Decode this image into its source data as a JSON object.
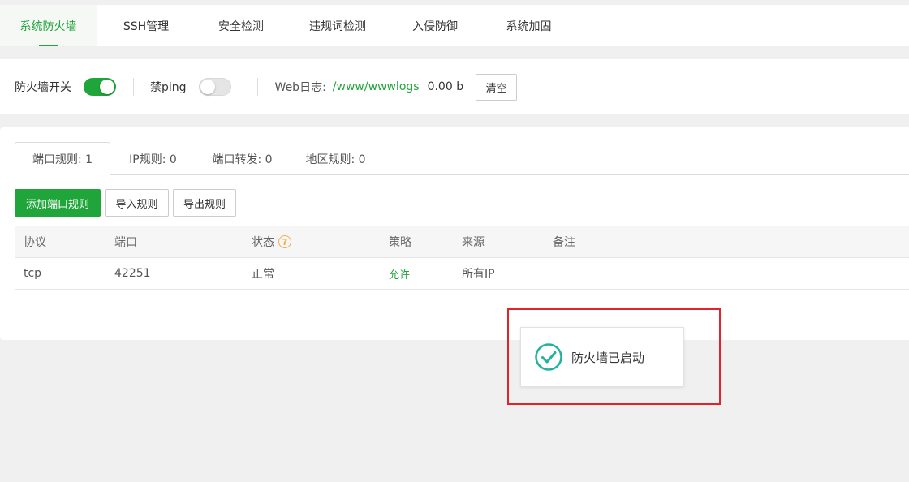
{
  "topnav": {
    "tabs": [
      {
        "label": "系统防火墙",
        "active": true
      },
      {
        "label": "SSH管理",
        "active": false
      },
      {
        "label": "安全检测",
        "active": false
      },
      {
        "label": "违规词检测",
        "active": false
      },
      {
        "label": "入侵防御",
        "active": false
      },
      {
        "label": "系统加固",
        "active": false
      }
    ]
  },
  "controls": {
    "firewall_label": "防火墙开关",
    "firewall_on": true,
    "ping_label": "禁ping",
    "ping_on": false,
    "weblog_label": "Web日志:",
    "weblog_path": "/www/wwwlogs",
    "weblog_size": "0.00 b",
    "clear_label": "清空"
  },
  "subtabs": [
    {
      "label": "端口规则: 1",
      "active": true
    },
    {
      "label": "IP规则: 0",
      "active": false
    },
    {
      "label": "端口转发: 0",
      "active": false
    },
    {
      "label": "地区规则: 0",
      "active": false
    }
  ],
  "actions": {
    "add_label": "添加端口规则",
    "import_label": "导入规则",
    "export_label": "导出规则"
  },
  "table": {
    "headers": {
      "protocol": "协议",
      "port": "端口",
      "status": "状态",
      "policy": "策略",
      "source": "来源",
      "note": "备注"
    },
    "rows": [
      {
        "protocol": "tcp",
        "port": "42251",
        "status": "正常",
        "policy": "允许",
        "source": "所有IP",
        "note": ""
      }
    ]
  },
  "toast": {
    "message": "防火墙已启动"
  },
  "colors": {
    "accent": "#20a53a",
    "warning": "#f0ad4e",
    "highlight": "#e0242a",
    "toast_check": "#20b2a0"
  }
}
